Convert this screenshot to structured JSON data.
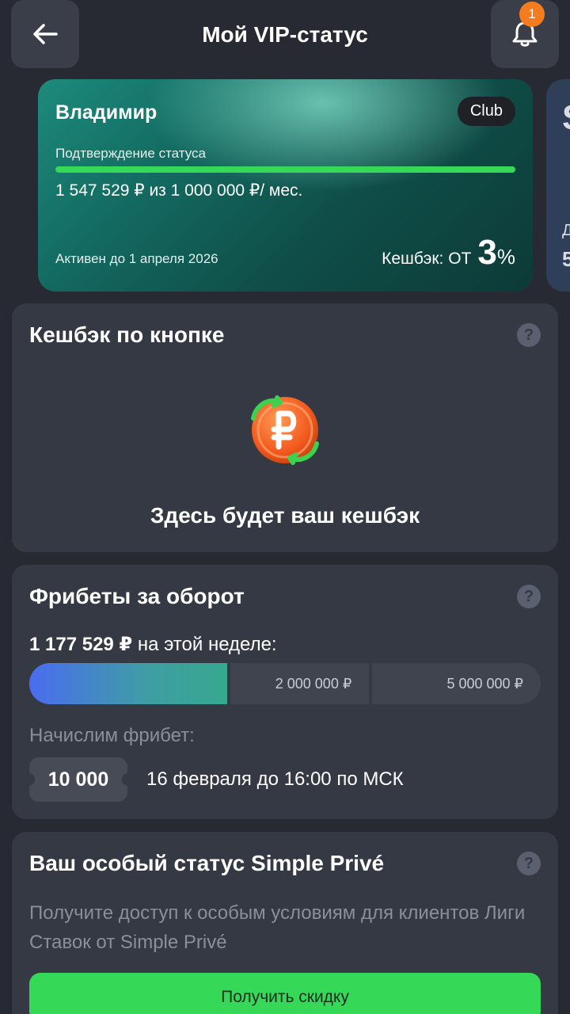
{
  "header": {
    "title": "Мой VIP-статус",
    "notification_count": "1",
    "back_icon": "arrow-left-icon",
    "bell_icon": "bell-icon"
  },
  "vip_card": {
    "name": "Владимир",
    "tier": "Club",
    "confirm_label": "Подтверждение статуса",
    "progress_fraction": 1.0,
    "amount_text": "1 547 529 ₽ из 1 000 000 ₽/ мес.",
    "active_until": "Активен до 1 апреля 2026",
    "cashback_label": "Кешбэк: ОТ",
    "cashback_value": "3",
    "cashback_sign": "%"
  },
  "next_card": {
    "big_glyph": "S",
    "line1": "Д",
    "line2": "5"
  },
  "cashback_panel": {
    "title": "Кешбэк по кнопке",
    "help": "?",
    "empty_text": "Здесь будет ваш кешбэк"
  },
  "freebets_panel": {
    "title": "Фрибеты за оборот",
    "help": "?",
    "week_amount": "1 177 529 ₽",
    "week_suffix": "на этой неделе:",
    "segments": [
      {
        "label": "",
        "fill_fraction": 1.0
      },
      {
        "label": "2 000 000 ₽",
        "fill_fraction": 0
      },
      {
        "label": "5 000 000 ₽",
        "fill_fraction": 0
      }
    ],
    "accrue_label": "Начислим фрибет:",
    "freebet_amount": "10 000",
    "freebet_date": "16 февраля до 16:00 по МСК"
  },
  "prive_panel": {
    "title": "Ваш особый статус Simple Privé",
    "help": "?",
    "description": "Получите доступ к особым условиям для клиентов Лиги Ставок от Simple Privé",
    "button_label": "Получить скидку"
  },
  "colors": {
    "background": "#272a32",
    "panel": "#353944",
    "accent_green": "#36d957",
    "badge_orange": "#f47b1e"
  }
}
